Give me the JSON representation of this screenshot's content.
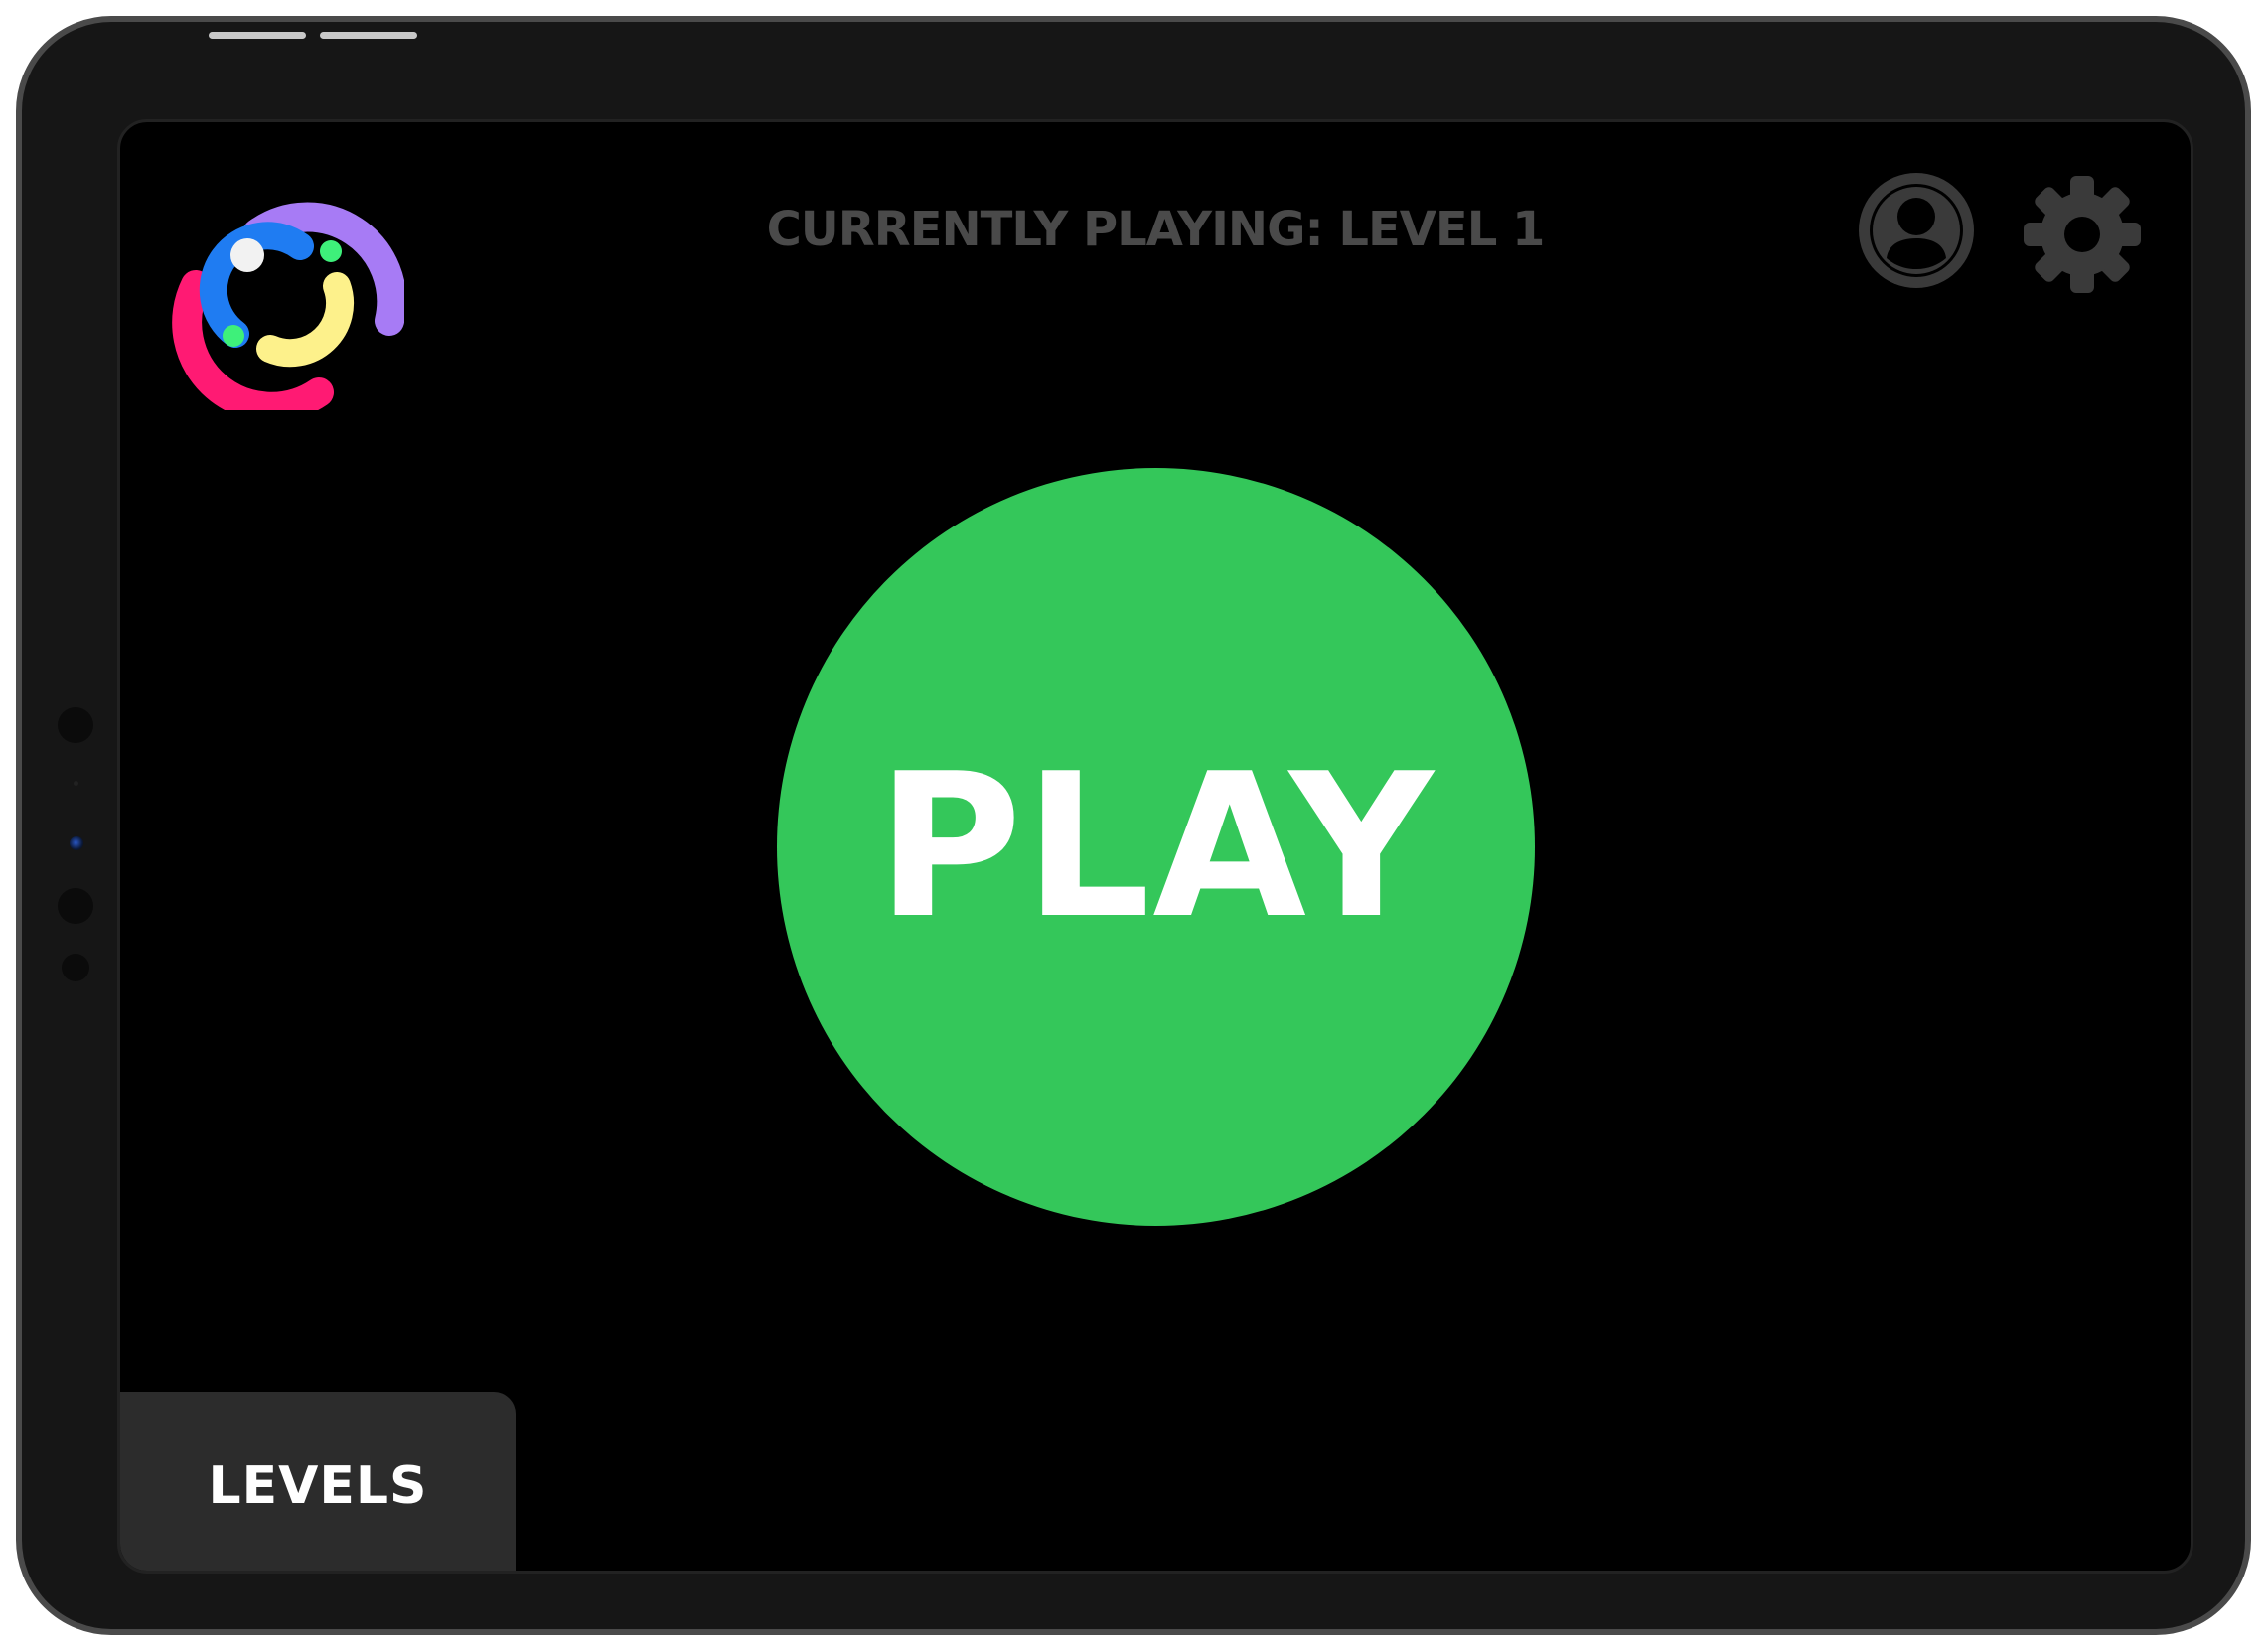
{
  "header": {
    "status_text": "CURRENTLY PLAYING: LEVEL 1"
  },
  "main": {
    "play_label": "PLAY"
  },
  "bottom_tab": {
    "levels_label": "LEVELS"
  },
  "icons": {
    "logo": "rings-logo",
    "profile": "profile-icon",
    "settings": "gear-icon"
  },
  "colors": {
    "screen_background": "#000000",
    "play_button": "#34c75a",
    "play_text": "#ffffff",
    "header_text": "#4a4a4a",
    "icon_gray": "#3a3a3a",
    "levels_tab": "#2c2c2c",
    "logo_purple": "#a77bf5",
    "logo_blue": "#1f7cf2",
    "logo_pink": "#ff1a73",
    "logo_yellow": "#fdf18b",
    "logo_green_dot": "#3ef07a",
    "logo_white_dot": "#f2f2f2"
  }
}
